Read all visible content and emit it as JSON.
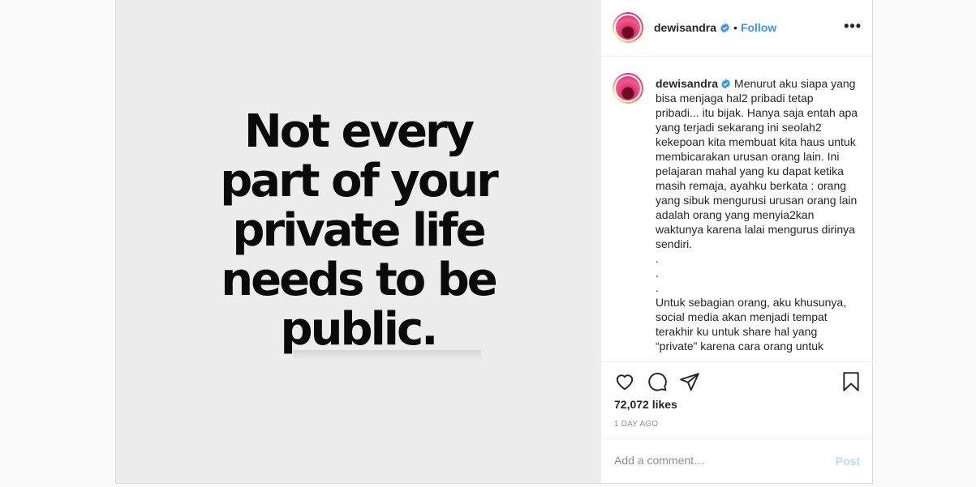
{
  "post": {
    "image_quote": [
      "Not every",
      "part of your",
      "private life",
      "needs to be",
      "public."
    ],
    "header": {
      "username": "dewisandra",
      "separator": "•",
      "follow_label": "Follow",
      "more_label": "•••"
    },
    "caption": {
      "username": "dewisandra",
      "lines_intro": "Menurut aku siapa yang bisa menjaga hal2 pribadi tetap pribadi... itu bijak. Hanya saja entah apa yang terjadi sekarang ini seolah2 kekepoan kita membuat kita haus untuk membicarakan urusan orang lain. Ini pelajaran mahal yang ku dapat ketika masih remaja, ayahku berkata : orang yang sibuk mengurusi urusan orang lain adalah orang yang menyia2kan waktunya karena lalai mengurus dirinya sendiri.",
      "dot1": ".",
      "dot2": ".",
      "dot3": ".",
      "lines_second": "Untuk sebagian orang, aku khusunya, social media akan menjadi tempat terakhir ku untuk share hal yang “private” karena cara orang untuk"
    },
    "likes": "72,072 likes",
    "time": "1 DAY AGO",
    "comment": {
      "placeholder": "Add a comment…",
      "post_label": "Post"
    },
    "icons": {
      "verified": "verified-badge-icon",
      "like": "heart-icon",
      "comment": "comment-icon",
      "share": "paper-plane-icon",
      "save": "bookmark-icon",
      "more": "ellipsis-icon"
    },
    "colors": {
      "accent": "#3897f0",
      "post_disabled": "#b2dffc",
      "muted": "#8e8e8e"
    }
  }
}
